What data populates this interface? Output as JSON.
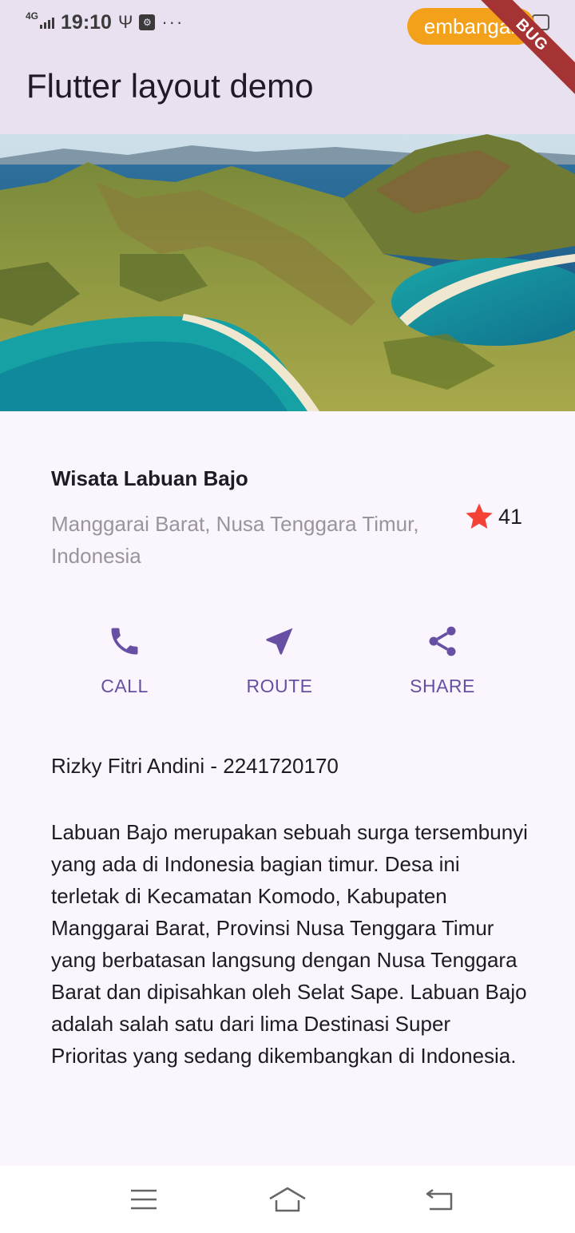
{
  "status_bar": {
    "network": "4G",
    "time": "19:10",
    "usb_symbol": "Ψ",
    "notification_box": "⚙",
    "more": "···",
    "pill_text": "embangar",
    "pill_color": "#f3a11a",
    "debug_banner": "BUG"
  },
  "app_bar": {
    "title": "Flutter layout demo",
    "background": "#e9e0f0"
  },
  "hero": {
    "description_icon": "landscape-photo"
  },
  "place": {
    "title": "Wisata Labuan Bajo",
    "location": "Manggarai Barat, Nusa Tenggara Timur, Indonesia",
    "rating_count": "41",
    "star_color": "#f44336"
  },
  "actions": [
    {
      "label": "CALL",
      "icon": "phone-icon"
    },
    {
      "label": "ROUTE",
      "icon": "near-me-icon"
    },
    {
      "label": "SHARE",
      "icon": "share-icon"
    }
  ],
  "accent_color": "#6750a4",
  "author": "Rizky Fitri Andini - 2241720170",
  "description": "Labuan Bajo merupakan sebuah surga tersembunyi yang ada di Indonesia bagian timur. Desa ini terletak di Kecamatan Komodo, Kabupaten Manggarai Barat, Provinsi Nusa Tenggara Timur yang berbatasan langsung dengan Nusa Tenggara Barat dan dipisahkan oleh Selat Sape. Labuan Bajo adalah salah satu dari lima Destinasi Super Prioritas yang sedang dikembangkan di Indonesia.",
  "nav_bar": {
    "menu": "menu-icon",
    "home": "home-icon",
    "back": "back-icon"
  }
}
